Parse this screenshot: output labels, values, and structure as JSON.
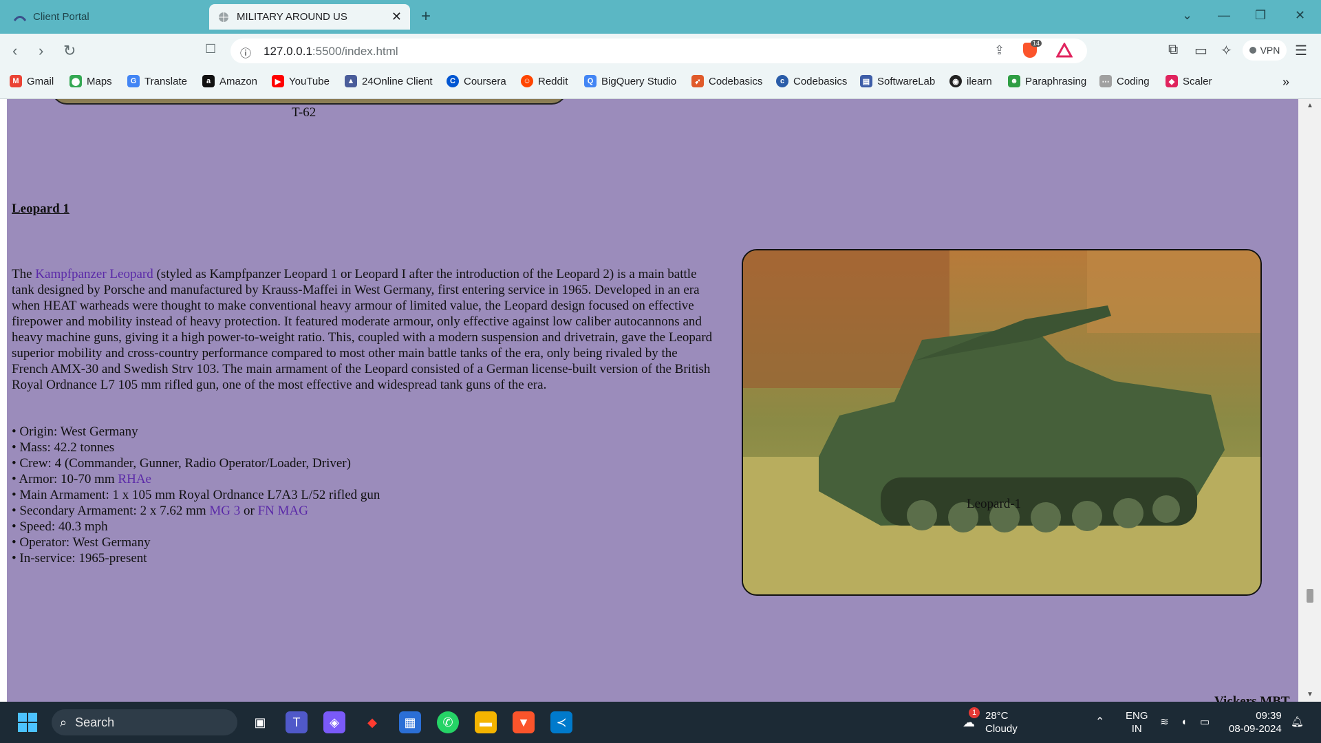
{
  "browser": {
    "tabs": [
      {
        "label": "Client Portal",
        "active": false
      },
      {
        "label": "MILITARY AROUND US",
        "active": true
      }
    ],
    "url_host": "127.0.0.1",
    "url_path": ":5500/index.html",
    "vpn_label": "VPN",
    "shield_count": "14"
  },
  "bookmarks": [
    {
      "label": "Gmail",
      "icon": "gmail-icon",
      "color": "#ea4335"
    },
    {
      "label": "Maps",
      "icon": "maps-icon",
      "color": "#34a853"
    },
    {
      "label": "Translate",
      "icon": "translate-icon",
      "color": "#4285f4"
    },
    {
      "label": "Amazon",
      "icon": "amazon-icon",
      "color": "#111111"
    },
    {
      "label": "YouTube",
      "icon": "youtube-icon",
      "color": "#ff0000"
    },
    {
      "label": "24Online Client",
      "icon": "24online-icon",
      "color": "#4a5d9a"
    },
    {
      "label": "Coursera",
      "icon": "coursera-icon",
      "color": "#0056d2"
    },
    {
      "label": "Reddit",
      "icon": "reddit-icon",
      "color": "#ff4500"
    },
    {
      "label": "BigQuery Studio",
      "icon": "bigquery-icon",
      "color": "#4285f4"
    },
    {
      "label": "Codebasics",
      "icon": "rocket-icon",
      "color": "#e05a2a"
    },
    {
      "label": "Codebasics",
      "icon": "codebasics-icon",
      "color": "#2a5ca8"
    },
    {
      "label": "SoftwareLab",
      "icon": "softwarelab-icon",
      "color": "#3e5ea8"
    },
    {
      "label": "ilearn",
      "icon": "ilearn-icon",
      "color": "#222222"
    },
    {
      "label": "Paraphrasing",
      "icon": "paraphrasing-icon",
      "color": "#2f9e44"
    },
    {
      "label": "Coding",
      "icon": "coding-icon",
      "color": "#a0a0a0"
    },
    {
      "label": "Scaler",
      "icon": "scaler-icon",
      "color": "#e0245e"
    }
  ],
  "page": {
    "prev_caption": "T-62",
    "heading": "Leopard 1",
    "para_intro": "The ",
    "para_link": "Kampfpanzer Leopard",
    "para_rest": " (styled as Kampfpanzer Leopard 1 or Leopard I after the introduction of the Leopard 2) is a main battle tank designed by Porsche and manufactured by Krauss-Maffei in West Germany, first entering service in 1965. Developed in an era when HEAT warheads were thought to make conventional heavy armour of limited value, the Leopard design focused on effective firepower and mobility instead of heavy protection. It featured moderate armour, only effective against low caliber autocannons and heavy machine guns, giving it a high power-to-weight ratio. This, coupled with a modern suspension and drivetrain, gave the Leopard superior mobility and cross-country performance compared to most other main battle tanks of the era, only being rivaled by the French AMX-30 and Swedish Strv 103. The main armament of the Leopard consisted of a German license-built version of the British Royal Ordnance L7 105 mm rifled gun, one of the most effective and widespread tank guns of the era.",
    "specs": {
      "origin": "• Origin: West Germany",
      "mass": "• Mass: 42.2 tonnes",
      "crew": "• Crew: 4 (Commander, Gunner, Radio Operator/Loader, Driver)",
      "armor_prefix": "• Armor: 10-70 mm ",
      "armor_link": "RHAe",
      "main_armament": "• Main Armament: 1 x 105 mm Royal Ordnance L7A3 L/52 rifled gun",
      "secondary_prefix": "• Secondary Armament: 2 x 7.62 mm ",
      "secondary_link1": "MG 3",
      "secondary_or": " or ",
      "secondary_link2": "FN MAG",
      "speed": "• Speed: 40.3 mph",
      "operator": "• Operator: West Germany",
      "in_service": "• In-service: 1965-present"
    },
    "image_caption": "Leopard-1",
    "next_heading_partial": "Vickers MBT"
  },
  "taskbar": {
    "search_label": "Search",
    "weather_temp": "28°C",
    "weather_desc": "Cloudy",
    "weather_badge": "1",
    "lang_top": "ENG",
    "lang_bottom": "IN",
    "time": "09:39",
    "date": "08-09-2024"
  }
}
